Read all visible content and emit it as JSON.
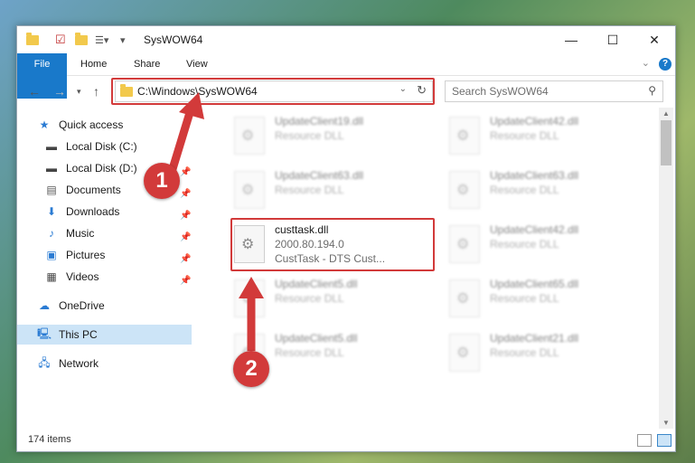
{
  "window": {
    "title": "SysWOW64",
    "controls": {
      "minimize": "—",
      "maximize": "☐",
      "close": "✕"
    }
  },
  "ribbon": {
    "tabs": [
      "File",
      "Home",
      "Share",
      "View"
    ],
    "help": "?"
  },
  "address": {
    "path": "C:\\Windows\\SysWOW64",
    "search_placeholder": "Search SysWOW64"
  },
  "sidebar": {
    "items": [
      {
        "label": "Quick access",
        "icon": "star-icon",
        "pinned": false
      },
      {
        "label": "Local Disk (C:)",
        "icon": "drive-icon",
        "pinned": true
      },
      {
        "label": "Local Disk (D:)",
        "icon": "drive-icon",
        "pinned": true
      },
      {
        "label": "Documents",
        "icon": "documents-icon",
        "pinned": true
      },
      {
        "label": "Downloads",
        "icon": "download-icon",
        "pinned": true
      },
      {
        "label": "Music",
        "icon": "music-icon",
        "pinned": true
      },
      {
        "label": "Pictures",
        "icon": "pictures-icon",
        "pinned": true
      },
      {
        "label": "Videos",
        "icon": "videos-icon",
        "pinned": true
      },
      {
        "label": "OneDrive",
        "icon": "cloud-icon",
        "pinned": false
      },
      {
        "label": "This PC",
        "icon": "computer-icon",
        "pinned": false,
        "selected": true
      },
      {
        "label": "Network",
        "icon": "network-icon",
        "pinned": false
      }
    ]
  },
  "files": {
    "left_column": [
      {
        "name": "UpdateClient19.dll",
        "desc": "Resource DLL"
      },
      {
        "name": "UpdateClient63.dll",
        "desc": "Resource DLL"
      },
      {
        "name": "custtask.dll",
        "desc": "2000.80.194.0",
        "sub": "CustTask - DTS Cust..."
      },
      {
        "name": "UpdateClient5.dll",
        "desc": "Resource DLL"
      },
      {
        "name": "UpdateClient5.dll",
        "desc": "Resource DLL"
      }
    ],
    "right_column": [
      {
        "name": "UpdateClient42.dll",
        "desc": "Resource DLL"
      },
      {
        "name": "UpdateClient63.dll",
        "desc": "Resource DLL"
      },
      {
        "name": "UpdateClient42.dll",
        "desc": "Resource DLL"
      },
      {
        "name": "UpdateClient65.dll",
        "desc": "Resource DLL"
      },
      {
        "name": "UpdateClient21.dll",
        "desc": "Resource DLL"
      }
    ]
  },
  "status": {
    "item_count": "174 items"
  },
  "annotations": {
    "step1": "1",
    "step2": "2",
    "color": "#d23a3a"
  }
}
